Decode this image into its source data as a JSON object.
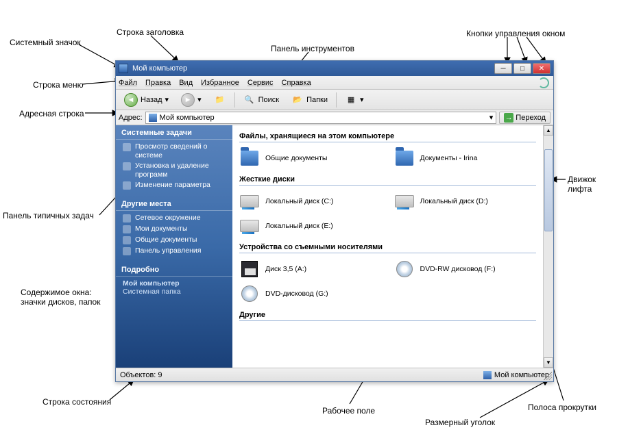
{
  "callouts": {
    "sys_icon": "Системный значок",
    "title_row": "Строка заголовка",
    "menu_row": "Строка меню",
    "addr_row": "Адресная строка",
    "task_panel": "Панель типичных задач",
    "contents": "Содержимое окна:\nзначки дисков, папок",
    "status_row": "Строка состояния",
    "toolbar": "Панель инструментов",
    "win_buttons": "Кнопки управления окном",
    "thumb": "Движок лифта",
    "work_area": "Рабочее поле",
    "resize": "Размерный уголок",
    "scrollbar": "Полоса прокрутки"
  },
  "titlebar": {
    "title": "Мой компьютер"
  },
  "menubar": [
    "Файл",
    "Правка",
    "Вид",
    "Избранное",
    "Сервис",
    "Справка"
  ],
  "toolbar": {
    "back": "Назад",
    "search": "Поиск",
    "folders": "Папки"
  },
  "addressbar": {
    "label": "Адрес:",
    "value": "Мой компьютер",
    "go": "Переход"
  },
  "taskpanel": {
    "sections": [
      {
        "title": "Системные задачи",
        "items": [
          "Просмотр сведений о системе",
          "Установка и удаление программ",
          "Изменение параметра"
        ]
      },
      {
        "title": "Другие места",
        "items": [
          "Сетевое окружение",
          "Мои документы",
          "Общие документы",
          "Панель управления"
        ]
      },
      {
        "title": "Подробно",
        "info_name": "Мой компьютер",
        "info_type": "Системная папка"
      }
    ]
  },
  "content": {
    "groups": [
      {
        "title": "Файлы, хранящиеся на этом компьютере",
        "items": [
          {
            "icon": "folder",
            "label": "Общие документы"
          },
          {
            "icon": "folder",
            "label": "Документы - Irina"
          }
        ]
      },
      {
        "title": "Жесткие диски",
        "items": [
          {
            "icon": "drive",
            "label": "Локальный диск (C:)"
          },
          {
            "icon": "drive",
            "label": "Локальный диск (D:)"
          },
          {
            "icon": "drive",
            "label": "Локальный диск (E:)"
          }
        ]
      },
      {
        "title": "Устройства со съемными носителями",
        "items": [
          {
            "icon": "floppy",
            "label": "Диск 3,5 (A:)"
          },
          {
            "icon": "cd",
            "label": "DVD-RW дисковод (F:)"
          },
          {
            "icon": "cd",
            "label": "DVD-дисковод (G:)"
          }
        ]
      },
      {
        "title": "Другие",
        "items": []
      }
    ]
  },
  "statusbar": {
    "left": "Объектов: 9",
    "right": "Мой компьютер"
  }
}
